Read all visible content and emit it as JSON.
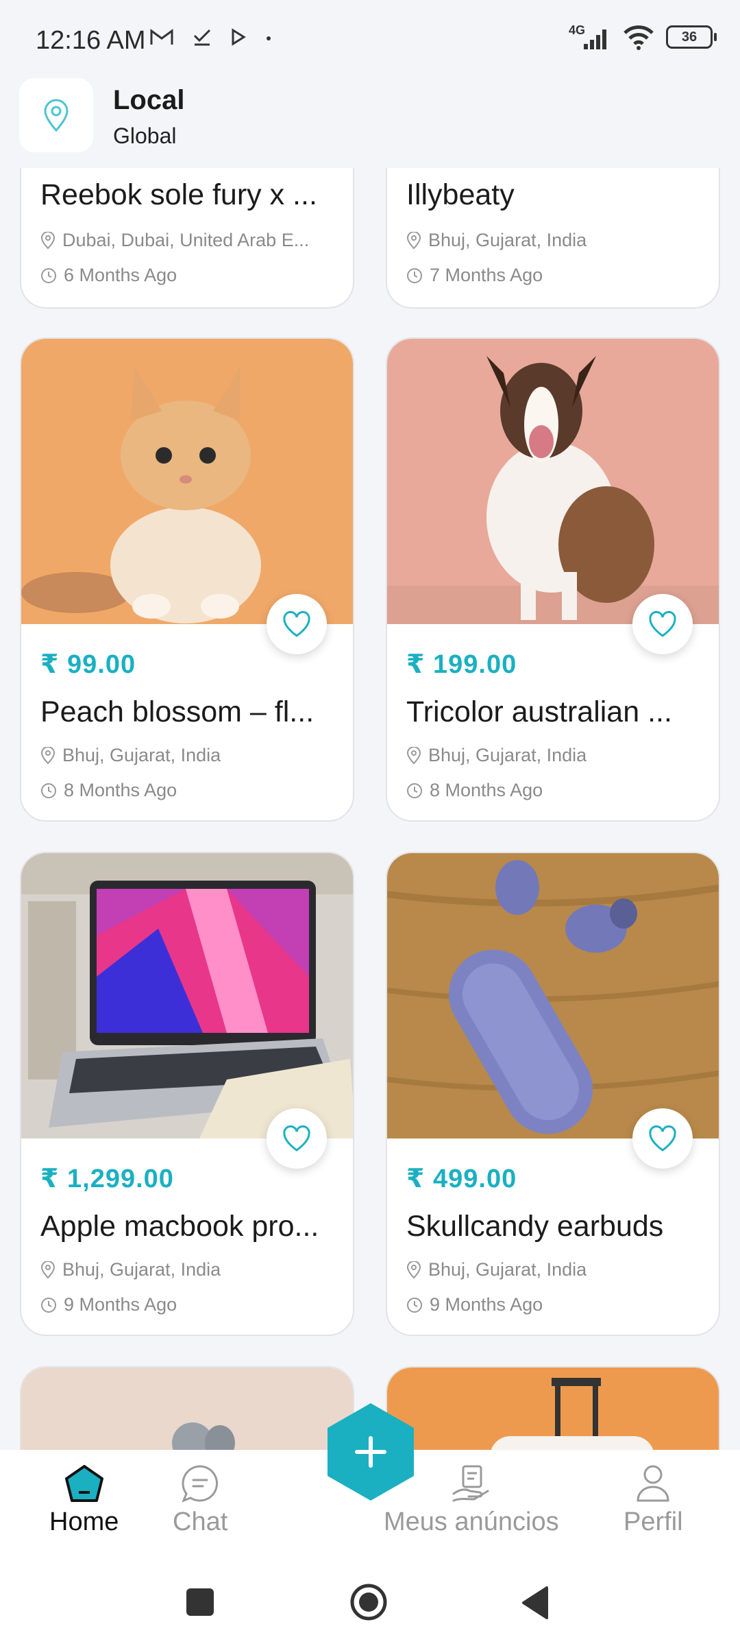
{
  "status_bar": {
    "time": "12:16 AM",
    "network": "4G",
    "battery": "36"
  },
  "header": {
    "title": "Local",
    "subtitle": "Global"
  },
  "cards": [
    {
      "title": "Reebok sole fury x ...",
      "location": "Dubai, Dubai, United Arab E...",
      "time": "6 Months Ago"
    },
    {
      "title": "Illybeaty",
      "location": "Bhuj, Gujarat, India",
      "time": "7 Months Ago"
    },
    {
      "price": "₹ 99.00",
      "title": "Peach blossom – fl...",
      "location": "Bhuj, Gujarat, India",
      "time": "8 Months Ago",
      "image": "kitten"
    },
    {
      "price": "₹ 199.00",
      "title": "Tricolor australian ...",
      "location": "Bhuj, Gujarat, India",
      "time": "8 Months Ago",
      "image": "dog"
    },
    {
      "price": "₹ 1,299.00",
      "title": "Apple macbook pro...",
      "location": "Bhuj, Gujarat, India",
      "time": "9 Months Ago",
      "image": "laptop"
    },
    {
      "price": "₹ 499.00",
      "title": "Skullcandy earbuds",
      "location": "Bhuj, Gujarat, India",
      "time": "9 Months Ago",
      "image": "earbuds"
    }
  ],
  "nav": {
    "home": "Home",
    "chat": "Chat",
    "ads": "Meus anúncios",
    "profile": "Perfil"
  },
  "colors": {
    "accent": "#1ab0c2",
    "background": "#f4f5f8"
  }
}
